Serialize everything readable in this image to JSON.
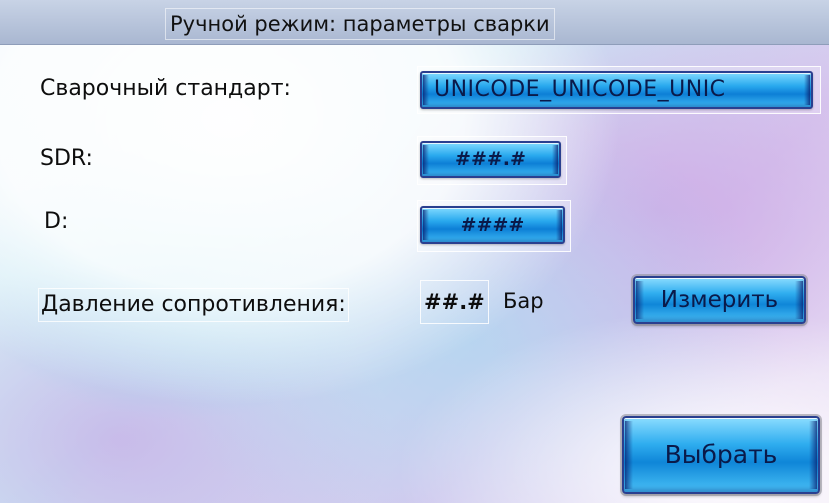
{
  "window": {
    "title": "Ручной режим: параметры сварки"
  },
  "form": {
    "standard": {
      "label": "Сварочный стандарт:",
      "value": "UNICODE_UNICODE_UNIC"
    },
    "sdr": {
      "label": "SDR:",
      "value": "###.#"
    },
    "d": {
      "label": "D:",
      "value": "####"
    },
    "drag_pressure": {
      "label": "Давление сопротивления:",
      "value": "##.#",
      "unit": "Бар"
    }
  },
  "buttons": {
    "measure_label": "Измерить",
    "select_label": "Выбрать"
  },
  "colors": {
    "title_bar": "#b8c4dc",
    "button_blue": "#29a9ee",
    "button_border": "#2a3f8f"
  }
}
